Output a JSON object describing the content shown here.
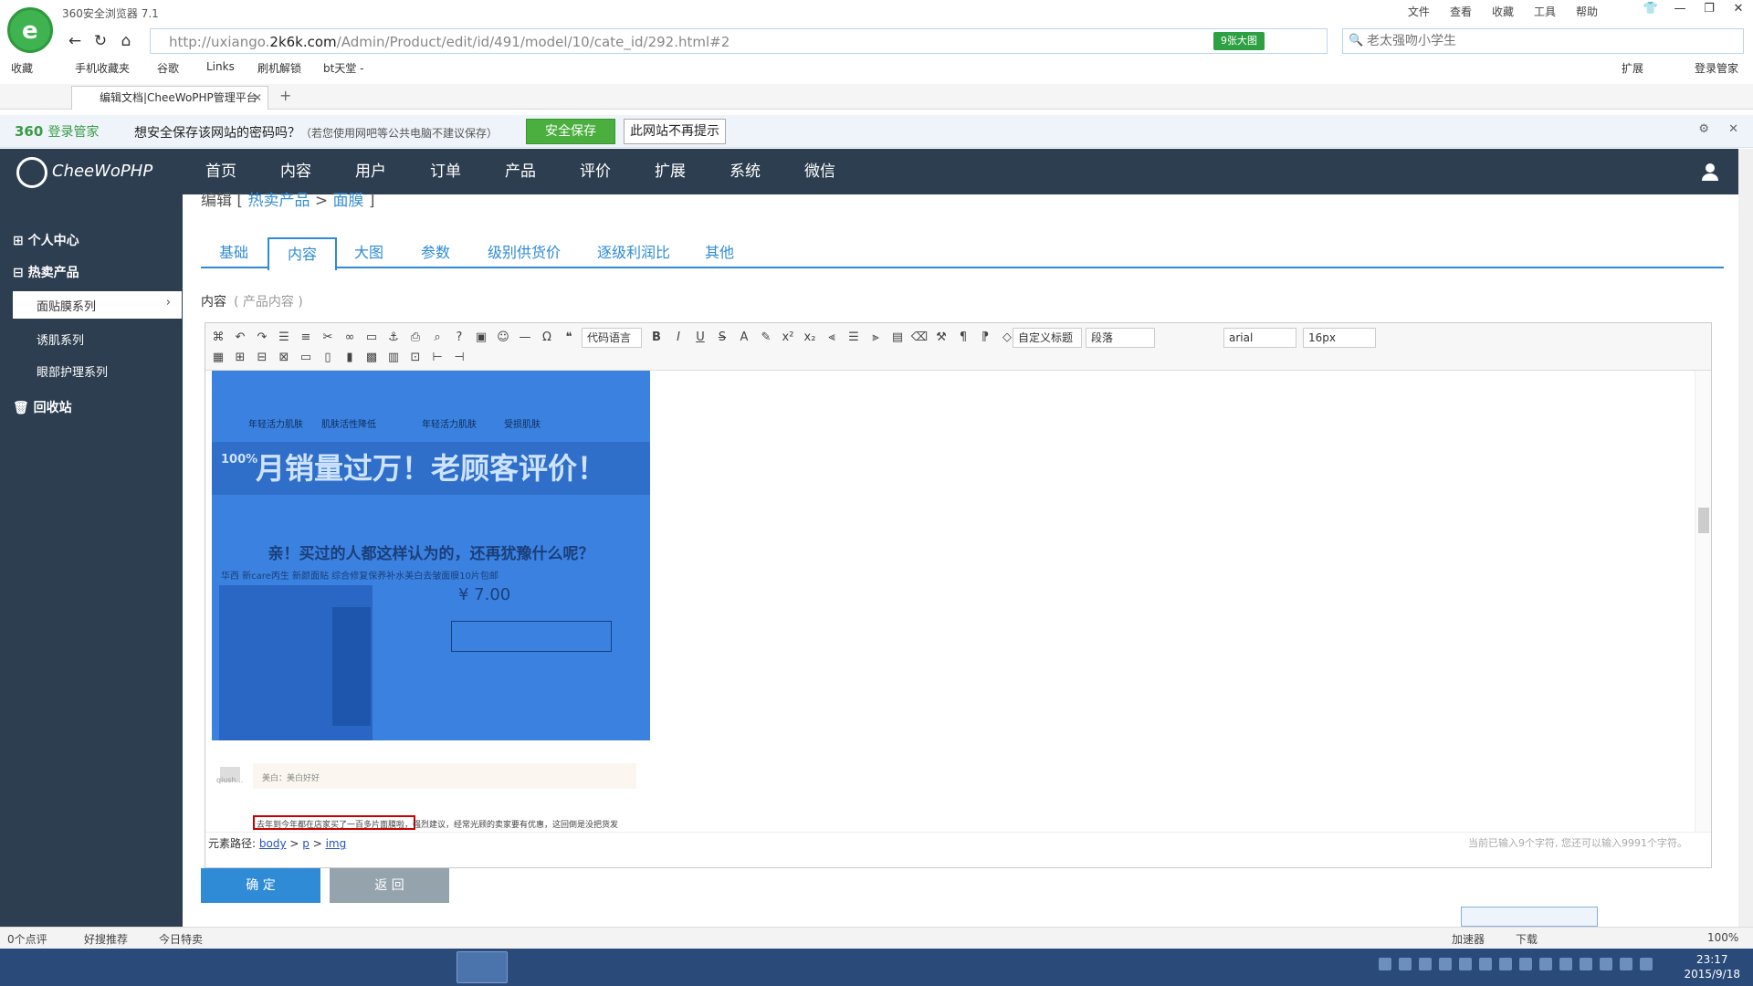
{
  "browser": {
    "title": "360安全浏览器 7.1",
    "menu": [
      "文件",
      "查看",
      "收藏",
      "工具",
      "帮助"
    ],
    "url_prefix": "http://uxiango.",
    "url_domain": "2k6k.com",
    "url_path": "/Admin/Product/edit/id/491/model/10/cate_id/292.html#2",
    "url_badge": "9张大图",
    "search_placeholder": "老太强吻小学生",
    "bookmarks": [
      "收藏",
      "手机收藏夹",
      "谷歌",
      "Links",
      "刷机解锁",
      "bt天堂 -"
    ],
    "bookmarks_right": [
      "扩展",
      "登录管家"
    ],
    "tab_title": "编辑文档|CheeWoPHP管理平台",
    "colors": {
      "accent": "#2f8bd6",
      "nav_bg": "#2c3e50",
      "green": "#4aaf3e"
    }
  },
  "password_bar": {
    "brand": "360",
    "brand_suffix": "登录管家",
    "message": "想安全保存该网站的密码吗？",
    "hint": "（若您使用网吧等公共电脑不建议保存）",
    "save_label": "安全保存",
    "no_show_label": "此网站不再提示"
  },
  "app": {
    "brand": "CheeWoPHP",
    "nav": [
      "首页",
      "内容",
      "用户",
      "订单",
      "产品",
      "评价",
      "扩展",
      "系统",
      "微信"
    ]
  },
  "sidebar": {
    "items": [
      {
        "label": "个人中心"
      },
      {
        "label": "热卖产品"
      }
    ],
    "sub_items": [
      "面贴膜系列",
      "诱肌系列",
      "眼部护理系列"
    ],
    "recycle": "回收站"
  },
  "main": {
    "breadcrumb_prefix": "编辑 [",
    "breadcrumb_cat": "热卖产品",
    "breadcrumb_sep": ">",
    "breadcrumb_sub": "面膜",
    "breadcrumb_suffix": "]",
    "tabs": [
      "基础",
      "内容",
      "大图",
      "参数",
      "级别供货价",
      "逐级利润比",
      "其他"
    ],
    "active_tab": "内容",
    "field_label": "内容",
    "field_hint": "( 产品内容 )"
  },
  "editor": {
    "selects": {
      "code_lang": "代码语言",
      "custom_title": "自定义标题",
      "paragraph": "段落",
      "font": "arial",
      "size": "16px"
    },
    "image_texts": {
      "slogan": "月销量过万！老顾客评价！",
      "ask": "亲！买过的人都这样认为的，还再犹豫什么呢？",
      "product_title": "华西 新care丙生 新颜面贴 综合修复保养补水美白去皱面膜10片包邮",
      "price": "¥ 7.00",
      "labels": [
        "年轻活力肌肤",
        "肌肤活性降低",
        "年轻活力肌肤",
        "受损肌肤"
      ],
      "badge": "100%"
    },
    "comment": {
      "bubble": "美白：美白好好",
      "name": "qiush...",
      "text": "去年到今年都在店家买了一百多片面膜啦，强烈建议，经常光顾的卖家要有优惠，这回倒是没把货发"
    },
    "path_label": "元素路径:",
    "path_items": [
      "body",
      "p",
      "img"
    ],
    "char_count": "当前已输入9个字符, 您还可以输入9991个字符。"
  },
  "actions": {
    "ok": "确 定",
    "back": "返 回"
  },
  "status": {
    "left": [
      "0个点评",
      "好搜推荐",
      "今日特卖"
    ],
    "right": [
      "加速器",
      "下载",
      "100%"
    ]
  },
  "taskbar": {
    "time": "23:17",
    "date": "2015/9/18"
  }
}
